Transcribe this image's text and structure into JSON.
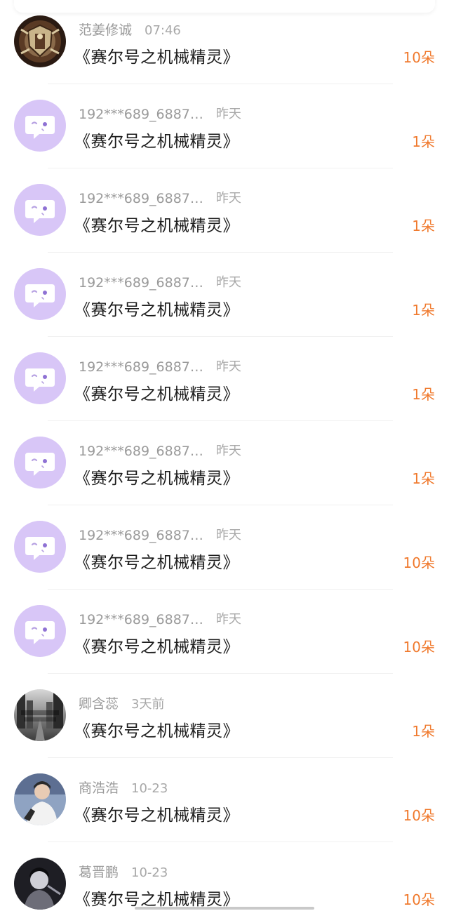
{
  "colors": {
    "accent_orange": "#f07a2e",
    "default_avatar_bg": "#d8c6f7",
    "name_gray": "#9a9a9a",
    "title_black": "#1c1c1c"
  },
  "gifts": [
    {
      "name": "范姜修诚",
      "time": "07:46",
      "title": "《赛尔号之机械精灵》",
      "amount": "10朵",
      "avatar": "custom-shield"
    },
    {
      "name": "192***689_6887…",
      "time": "昨天",
      "title": "《赛尔号之机械精灵》",
      "amount": "1朵",
      "avatar": "default"
    },
    {
      "name": "192***689_6887…",
      "time": "昨天",
      "title": "《赛尔号之机械精灵》",
      "amount": "1朵",
      "avatar": "default"
    },
    {
      "name": "192***689_6887…",
      "time": "昨天",
      "title": "《赛尔号之机械精灵》",
      "amount": "1朵",
      "avatar": "default"
    },
    {
      "name": "192***689_6887…",
      "time": "昨天",
      "title": "《赛尔号之机械精灵》",
      "amount": "1朵",
      "avatar": "default"
    },
    {
      "name": "192***689_6887…",
      "time": "昨天",
      "title": "《赛尔号之机械精灵》",
      "amount": "1朵",
      "avatar": "default"
    },
    {
      "name": "192***689_6887…",
      "time": "昨天",
      "title": "《赛尔号之机械精灵》",
      "amount": "10朵",
      "avatar": "default"
    },
    {
      "name": "192***689_6887…",
      "time": "昨天",
      "title": "《赛尔号之机械精灵》",
      "amount": "10朵",
      "avatar": "default"
    },
    {
      "name": "卿含蕊",
      "time": "3天前",
      "title": "《赛尔号之机械精灵》",
      "amount": "1朵",
      "avatar": "custom-street"
    },
    {
      "name": "商浩浩",
      "time": "10-23",
      "title": "《赛尔号之机械精灵》",
      "amount": "10朵",
      "avatar": "custom-person"
    },
    {
      "name": "葛晋鹏",
      "time": "10-23",
      "title": "《赛尔号之机械精灵》",
      "amount": "10朵",
      "avatar": "custom-portrait"
    }
  ]
}
